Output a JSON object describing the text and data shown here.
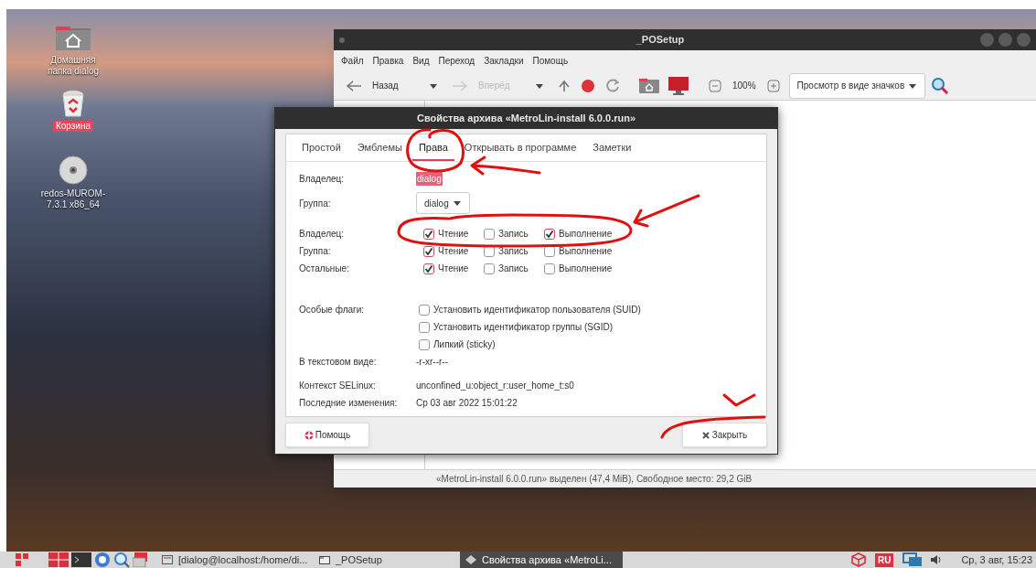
{
  "desktop": {
    "icons": [
      {
        "kind": "home",
        "label": "Домашняя папка dialog",
        "selected": false
      },
      {
        "kind": "trash",
        "label": "Корзина",
        "selected": true
      },
      {
        "kind": "disc",
        "label": "redos-MUROM-7.3.1 x86_64",
        "selected": false
      }
    ]
  },
  "file_manager": {
    "title": "_POSetup",
    "menu": [
      "Файл",
      "Правка",
      "Вид",
      "Переход",
      "Закладки",
      "Помощь"
    ],
    "nav": [
      {
        "kind": "back",
        "label": "Назад",
        "disabled": false
      },
      {
        "kind": "forward",
        "label": "Вперёд",
        "disabled": true
      }
    ],
    "zoom": "100%",
    "view_mode": "Просмотр в виде значков",
    "status_bar": "«MetroLin-install 6.0.0.run» выделен (47,4 MiB), Свободное место: 29,2 GiB"
  },
  "dialog": {
    "title": "Свойства архива «MetroLin-install 6.0.0.run»",
    "tabs": [
      {
        "label": "Простой",
        "selected": false
      },
      {
        "label": "Эмблемы",
        "selected": false
      },
      {
        "label": "Права",
        "selected": true
      },
      {
        "label": "Открывать в программе",
        "selected": false
      },
      {
        "label": "Заметки",
        "selected": false
      }
    ],
    "owner": {
      "label": "Владелец:",
      "value": "dialog"
    },
    "group": {
      "label": "Группа:",
      "value": "dialog"
    },
    "permissions": [
      {
        "label": "Владелец:",
        "options": [
          {
            "label": "Чтение",
            "checked": true
          },
          {
            "label": "Запись",
            "checked": false
          },
          {
            "label": "Выполнение",
            "checked": true
          }
        ]
      },
      {
        "label": "Группа:",
        "options": [
          {
            "label": "Чтение",
            "checked": true
          },
          {
            "label": "Запись",
            "checked": false
          },
          {
            "label": "Выполнение",
            "checked": false
          }
        ]
      },
      {
        "label": "Остальные:",
        "options": [
          {
            "label": "Чтение",
            "checked": true
          },
          {
            "label": "Запись",
            "checked": false
          },
          {
            "label": "Выполнение",
            "checked": false
          }
        ]
      }
    ],
    "special_flags": {
      "label": "Особые флаги:",
      "options": [
        {
          "label": "Установить идентификатор пользователя (SUID)",
          "checked": false
        },
        {
          "label": "Установить идентификатор группы (SGID)",
          "checked": false
        },
        {
          "label": "Липкий (sticky)",
          "checked": false
        }
      ]
    },
    "text_view": {
      "label": "В текстовом виде:",
      "value": "-r-xr--r--"
    },
    "info": [
      {
        "label": "Контекст SELinux:",
        "value": "unconfined_u:object_r:user_home_t:s0"
      },
      {
        "label": "Последние изменения:",
        "value": "Ср 03 авг 2022 15:01:22"
      }
    ],
    "help_button": "Помощь",
    "close_button": "Закрыть"
  },
  "taskbar": {
    "tasks": [
      {
        "kind": "terminal",
        "label": "[dialog@localhost:/home/di...",
        "selected": false
      },
      {
        "kind": "folder",
        "label": "_POSetup",
        "selected": false
      },
      {
        "kind": "dialog",
        "label": "Свойства архива «MetroLi...",
        "selected": true
      }
    ],
    "language": "RU",
    "clock": "Ср, 3 авг, 15:23"
  }
}
